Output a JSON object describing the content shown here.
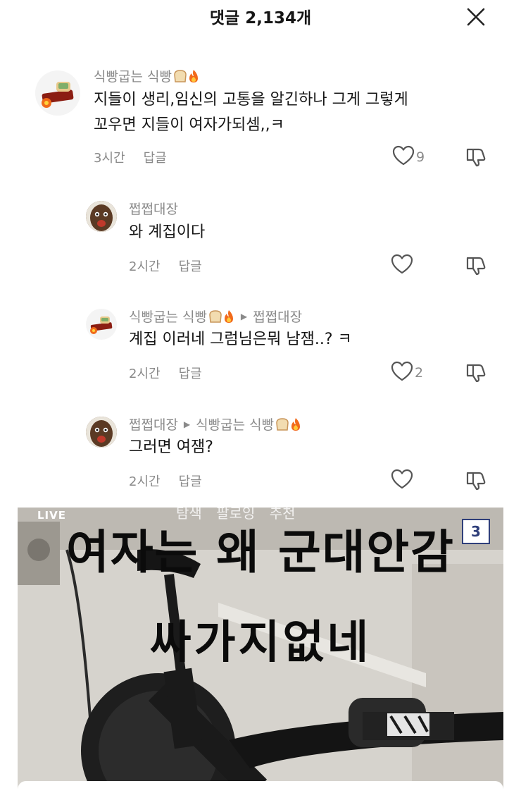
{
  "header": {
    "title": "댓글 2,134개"
  },
  "comments": [
    {
      "author": "식빵굽는 식빵",
      "text_line1": "지들이 생리,임신의 고통을 알긴하나 그게 그렇게",
      "text_line2": "꼬우면 지들이 여자가되셈,,ㅋ",
      "time": "3시간",
      "reply_label": "답글",
      "likes": "9"
    },
    {
      "author": "쩝쩝대장",
      "text": "와 계집이다",
      "time": "2시간",
      "reply_label": "답글",
      "likes": ""
    },
    {
      "author": "식빵굽는 식빵",
      "reply_to": "쩝쩝대장",
      "text": "계집 이러네 그럼님은뭐 남잼..? ㅋ",
      "time": "2시간",
      "reply_label": "답글",
      "likes": "2"
    },
    {
      "author": "쩝쩝대장",
      "reply_to": "식빵굽는 식빵",
      "text": "그러면 여잼?",
      "time": "2시간",
      "reply_label": "답글",
      "likes": ""
    }
  ],
  "video": {
    "live_label": "LIVE",
    "top_tabs": "탐색 팔로잉 추천",
    "page_badge": "3",
    "caption_line1": "여자는 왜 군대안감",
    "caption_line2": "싸가지없네"
  },
  "colors": {
    "text": "#161616",
    "muted": "#8a8a8a",
    "badge_border": "#2f3f7a"
  }
}
